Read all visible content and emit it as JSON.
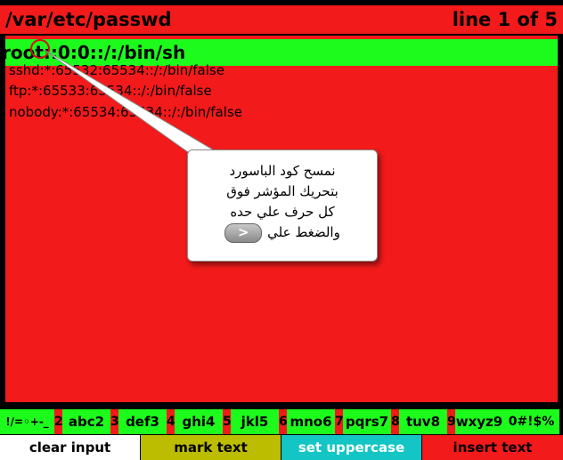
{
  "title": {
    "path": "/var/etc/passwd",
    "line_info": "line 1 of 5"
  },
  "editor": {
    "current_line": "root::0:0::/:/bin/sh",
    "lines": [
      "sshd:*:65532:65534::/:/bin/false",
      "ftp:*:65533:65534::/:/bin/false",
      "nobody:*:65534:65534::/:/bin/false"
    ]
  },
  "callout": {
    "line1": "نمسح كود الباسورد",
    "line2": "بتحريك المؤشر فوق",
    "line3": "كل حرف علي حده",
    "line4": "والضغط علي",
    "button_label": "<"
  },
  "keys": [
    {
      "num": "1",
      "chars": "!/=◦+-_"
    },
    {
      "num": "2",
      "chars": "abc2"
    },
    {
      "num": "3",
      "chars": "def3"
    },
    {
      "num": "4",
      "chars": "ghi4"
    },
    {
      "num": "5",
      "chars": "jkl5"
    },
    {
      "num": "6",
      "chars": "mno6"
    },
    {
      "num": "7",
      "chars": "pqrs7"
    },
    {
      "num": "8",
      "chars": "tuv8"
    },
    {
      "num": "9",
      "chars": "wxyz9"
    },
    {
      "num": "0",
      "chars": "0#!$%"
    }
  ],
  "actions": {
    "clear_input": "clear input",
    "mark_text": "mark text",
    "set_uppercase": "set uppercase",
    "insert_text": "insert text"
  },
  "colors": {
    "red": "#f21a1a",
    "green": "#1dfb1d",
    "white": "#ffffff",
    "olive": "#bcbc00",
    "cyan": "#13c5c5"
  }
}
